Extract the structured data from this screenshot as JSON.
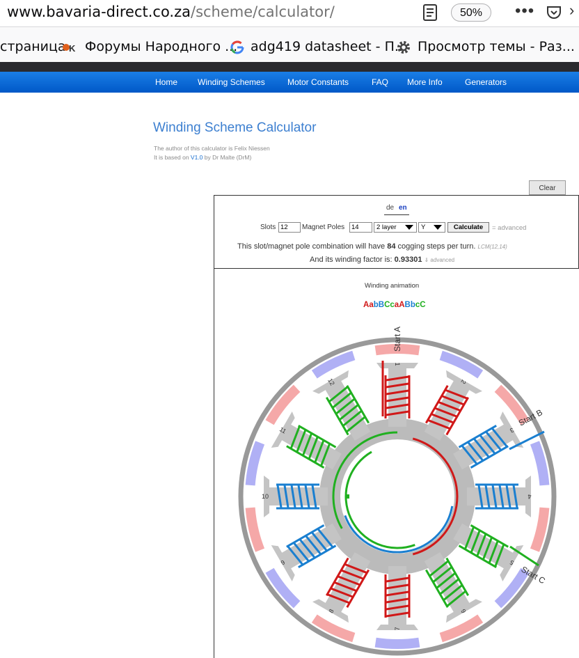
{
  "browser": {
    "url_host": "www.bavaria-direct.co.za",
    "url_path": "/scheme/calculator/",
    "zoom": "50%",
    "more": "•••",
    "bookmarks": [
      {
        "label": "страница"
      },
      {
        "label": "Форумы Народного ..."
      },
      {
        "label": "adg419 datasheet - П..."
      },
      {
        "label": "Просмотр темы - Раз..."
      }
    ]
  },
  "nav": [
    "Home",
    "Winding Schemes",
    "Motor Constants",
    "FAQ",
    "More Info",
    "Generators"
  ],
  "page": {
    "title": "Winding Scheme Calculator",
    "author": "The author of this calculator is Felix Niessen",
    "based_prefix": "It is based on ",
    "based_link": "V1.0",
    "based_suffix": " by Dr Malte (DrM)",
    "clear": "Clear"
  },
  "calculator": {
    "lang_de": "de",
    "lang_en": "en",
    "slots_label": "Slots",
    "slots_value": "12",
    "poles_label": "Magnet Poles",
    "poles_value": "14",
    "layer": "2 layer",
    "connection": "Y",
    "calculate": "Calculate",
    "advanced": "= advanced",
    "cog_prefix": "This slot/magnet pole combination will have ",
    "cog_value": "84",
    "cog_suffix": " cogging steps per turn.",
    "lcm": "LCM(12,14)",
    "wf_prefix": "And its winding factor is: ",
    "wf_value": "0.93301",
    "wf_advanced": "⇓ advanced"
  },
  "animation": {
    "title": "Winding animation",
    "sequence": [
      {
        "ch": "A",
        "color": "#d01818"
      },
      {
        "ch": "a",
        "color": "#d01818"
      },
      {
        "ch": "b",
        "color": "#1a7fd0"
      },
      {
        "ch": "B",
        "color": "#1a7fd0"
      },
      {
        "ch": "C",
        "color": "#20b020"
      },
      {
        "ch": "c",
        "color": "#20b020"
      },
      {
        "ch": "a",
        "color": "#d01818"
      },
      {
        "ch": "A",
        "color": "#d01818"
      },
      {
        "ch": "B",
        "color": "#1a7fd0"
      },
      {
        "ch": "b",
        "color": "#1a7fd0"
      },
      {
        "ch": "c",
        "color": "#20b020"
      },
      {
        "ch": "C",
        "color": "#20b020"
      }
    ],
    "start_a": "Start A",
    "start_b": "Start B",
    "start_c": "Start C",
    "slot_numbers": [
      "1",
      "2",
      "3",
      "4",
      "5",
      "6",
      "7",
      "8",
      "9",
      "10",
      "11",
      "12"
    ]
  }
}
